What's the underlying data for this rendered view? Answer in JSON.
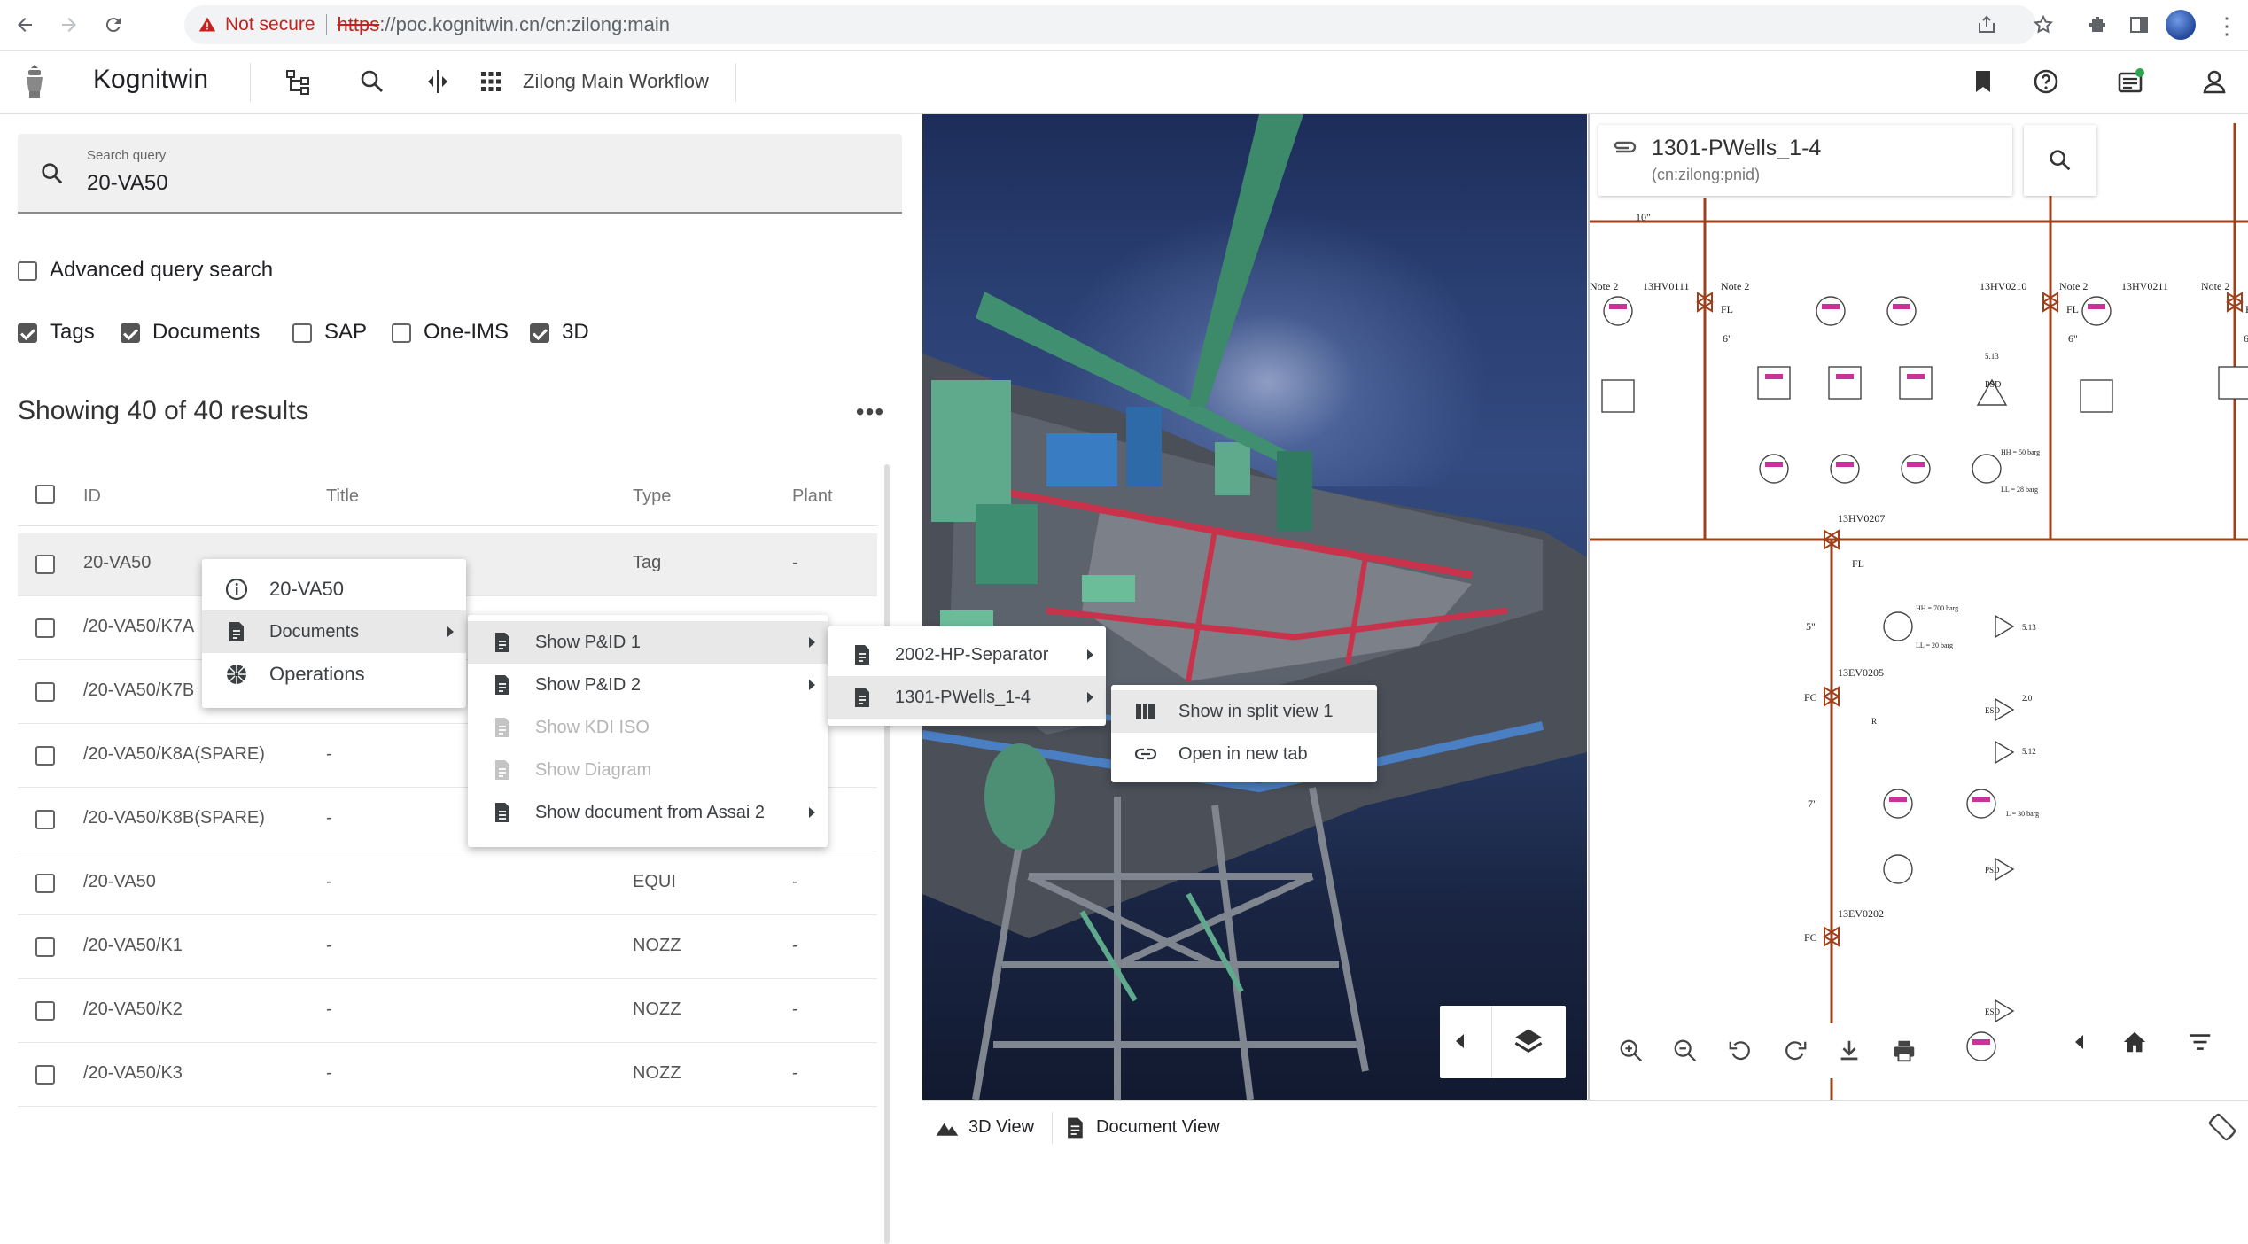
{
  "browser": {
    "security_label": "Not secure",
    "url_scheme": "https",
    "url_rest": "://poc.kognitwin.cn/cn:zilong:main"
  },
  "app": {
    "title": "Kognitwin",
    "workflow": "Zilong Main Workflow"
  },
  "search": {
    "label": "Search query",
    "value": "20-VA50",
    "advanced_label": "Advanced query search",
    "filters": [
      {
        "label": "Tags",
        "checked": true
      },
      {
        "label": "Documents",
        "checked": true
      },
      {
        "label": "SAP",
        "checked": false
      },
      {
        "label": "One-IMS",
        "checked": false
      },
      {
        "label": "3D",
        "checked": true
      }
    ],
    "results_count": "Showing 40 of 40 results"
  },
  "table": {
    "headers": [
      "ID",
      "Title",
      "Type",
      "Plant"
    ],
    "rows": [
      {
        "id": "20-VA50",
        "title": "",
        "type": "Tag",
        "plant": "-"
      },
      {
        "id": "/20-VA50/K7A",
        "title": "",
        "type": "",
        "plant": ""
      },
      {
        "id": "/20-VA50/K7B",
        "title": "",
        "type": "",
        "plant": ""
      },
      {
        "id": "/20-VA50/K8A(SPARE)",
        "title": "-",
        "type": "",
        "plant": ""
      },
      {
        "id": "/20-VA50/K8B(SPARE)",
        "title": "-",
        "type": "",
        "plant": ""
      },
      {
        "id": "/20-VA50",
        "title": "-",
        "type": "EQUI",
        "plant": "-"
      },
      {
        "id": "/20-VA50/K1",
        "title": "-",
        "type": "NOZZ",
        "plant": "-"
      },
      {
        "id": "/20-VA50/K2",
        "title": "-",
        "type": "NOZZ",
        "plant": "-"
      },
      {
        "id": "/20-VA50/K3",
        "title": "-",
        "type": "NOZZ",
        "plant": "-"
      }
    ]
  },
  "context_menu": {
    "level1": [
      {
        "label": "20-VA50",
        "icon": "info-icon"
      },
      {
        "label": "Documents",
        "icon": "document-icon"
      },
      {
        "label": "Operations",
        "icon": "aperture-icon"
      }
    ],
    "level2": [
      {
        "label": "Show P&ID 1"
      },
      {
        "label": "Show P&ID 2"
      },
      {
        "label": "Show KDI ISO"
      },
      {
        "label": "Show Diagram"
      },
      {
        "label": "Show document from Assai 2"
      }
    ],
    "level3": [
      {
        "label": "2002-HP-Separator"
      },
      {
        "label": "1301-PWells_1-4"
      }
    ],
    "level4": [
      {
        "label": "Show in split view 1"
      },
      {
        "label": "Open in new tab"
      }
    ]
  },
  "document": {
    "title": "1301-PWells_1-4",
    "subtitle": "(cn:zilong:pnid)"
  },
  "pid": {
    "labels": [
      "10\"",
      "Note 2",
      "13HV0111",
      "Note 2",
      "13HV0210",
      "Note 2",
      "13HV0211",
      "Note 2",
      "FL",
      "FL",
      "FL",
      "6\"",
      "6\"",
      "6\"",
      "13HV0207",
      "FL",
      "5\"",
      "13EV0205",
      "FC",
      "7\"",
      "13EV0202",
      "FC",
      "PSD",
      "5.13",
      "HH = 700 barg",
      "LL = 20 barg",
      "HH = 50 barg",
      "LL = 28 barg",
      "L = 30 barg",
      "2.0",
      "5.12",
      "5.13",
      "ESD",
      "R",
      "ESD",
      "PSD"
    ]
  },
  "bottom_tabs": [
    {
      "label": "3D View"
    },
    {
      "label": "Document View"
    }
  ]
}
